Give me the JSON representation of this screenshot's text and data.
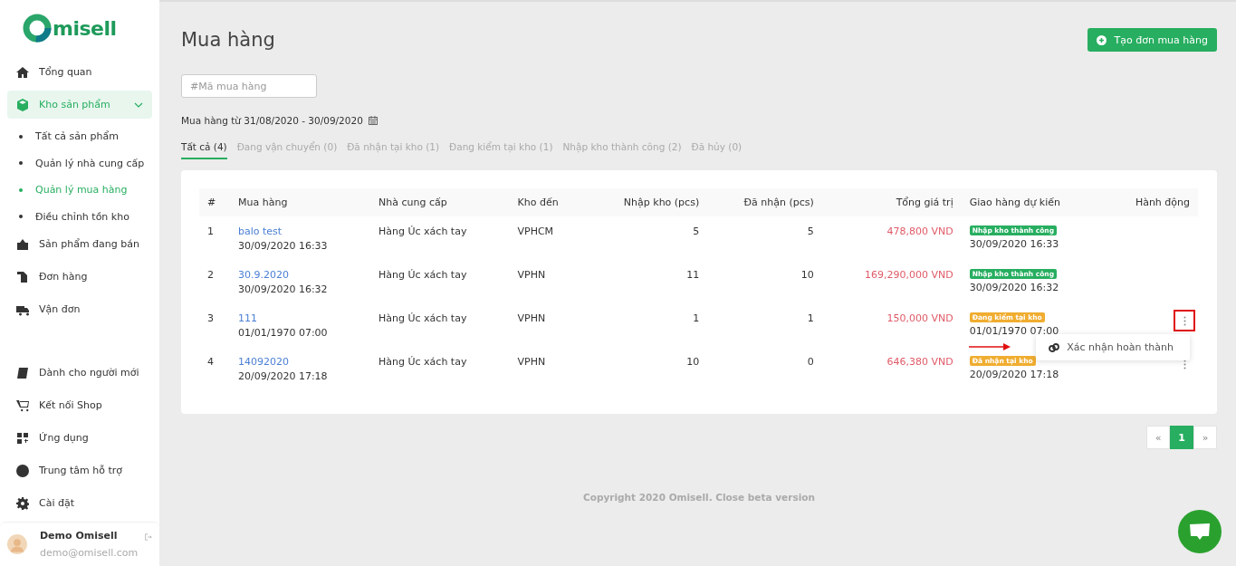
{
  "logo": {
    "text": "misell"
  },
  "sidebar": {
    "items": [
      {
        "kind": "main",
        "label": "Tổng quan",
        "selected": false
      },
      {
        "kind": "group",
        "label": "Kho sản phẩm",
        "selected": true,
        "expanded": true,
        "children": [
          {
            "label": "Tất cả sản phẩm",
            "selected": false
          },
          {
            "label": "Quản lý nhà cung cấp",
            "selected": false
          },
          {
            "label": "Quản lý mua hàng",
            "selected": true
          },
          {
            "label": "Điều chỉnh tồn kho",
            "selected": false
          }
        ]
      },
      {
        "kind": "main",
        "label": "Sản phẩm đang bán",
        "selected": false
      },
      {
        "kind": "main",
        "label": "Đơn hàng",
        "selected": false
      },
      {
        "kind": "main",
        "label": "Vận đơn",
        "selected": false
      },
      {
        "kind": "spacer"
      },
      {
        "kind": "main",
        "label": "Dành cho người mới",
        "selected": false
      },
      {
        "kind": "main",
        "label": "Kết nối Shop",
        "selected": false
      },
      {
        "kind": "main",
        "label": "Ứng dụng",
        "selected": false
      },
      {
        "kind": "main",
        "label": "Trung tâm hỗ trợ",
        "selected": false
      },
      {
        "kind": "main",
        "label": "Cài đặt",
        "selected": false
      }
    ]
  },
  "user": {
    "name": "Demo Omisell",
    "email": "demo@omisell.com"
  },
  "page": {
    "title": "Mua hàng",
    "create_button": "Tạo đơn mua hàng",
    "search": {
      "placeholder": "#Mã mua hàng"
    },
    "date_range": "Mua hàng từ 31/08/2020 - 30/09/2020"
  },
  "tabs": [
    {
      "label": "Tất cả (4)",
      "selected": true
    },
    {
      "label": "Đang vận chuyển (0)",
      "selected": false
    },
    {
      "label": "Đã nhận tại kho (1)",
      "selected": false
    },
    {
      "label": "Đang kiểm tại kho (1)",
      "selected": false
    },
    {
      "label": "Nhập kho thành công (2)",
      "selected": false
    },
    {
      "label": "Đã hủy (0)",
      "selected": false
    }
  ],
  "table": {
    "columns": [
      "#",
      "Mua hàng",
      "Nhà cung cấp",
      "Kho đến",
      "Nhập kho (pcs)",
      "Đã nhận (pcs)",
      "Tổng giá trị",
      "Giao hàng dự kiến",
      "Hành động"
    ],
    "rows": [
      {
        "index": "1",
        "name": "balo test",
        "created": "30/09/2020 16:33",
        "supplier": "Hàng Úc xách tay",
        "warehouse": "VPHCM",
        "imported": "5",
        "received": "5",
        "total": "478,800 VND",
        "status": {
          "label": "Nhập kho thành công",
          "kind": "success"
        },
        "delivery": "30/09/2020 16:33",
        "has_actions": false,
        "menu_open": false
      },
      {
        "index": "2",
        "name": "30.9.2020",
        "created": "30/09/2020 16:32",
        "supplier": "Hàng Úc xách tay",
        "warehouse": "VPHN",
        "imported": "11",
        "received": "10",
        "total": "169,290,000 VND",
        "status": {
          "label": "Nhập kho thành công",
          "kind": "success"
        },
        "delivery": "30/09/2020 16:32",
        "has_actions": false,
        "menu_open": false
      },
      {
        "index": "3",
        "name": "111",
        "created": "01/01/1970 07:00",
        "supplier": "Hàng Úc xách tay",
        "warehouse": "VPHN",
        "imported": "1",
        "received": "1",
        "total": "150,000 VND",
        "status": {
          "label": "Đang kiểm tại kho",
          "kind": "warning"
        },
        "delivery": "01/01/1970 07:00",
        "has_actions": true,
        "menu_open": true
      },
      {
        "index": "4",
        "name": "14092020",
        "created": "20/09/2020 17:18",
        "supplier": "Hàng Úc xách tay",
        "warehouse": "VPHN",
        "imported": "10",
        "received": "0",
        "total": "646,380 VND",
        "status": {
          "label": "Đã nhận tại kho",
          "kind": "warning"
        },
        "delivery": "20/09/2020 17:18",
        "has_actions": true,
        "menu_open": false
      }
    ]
  },
  "action_menu": {
    "items": [
      "Xác nhận hoàn thành"
    ]
  },
  "pagination": {
    "prev": "«",
    "next": "»",
    "pages": [
      {
        "label": "1",
        "selected": true
      }
    ]
  },
  "footer": "Copyright 2020 Omisell. Close beta version"
}
